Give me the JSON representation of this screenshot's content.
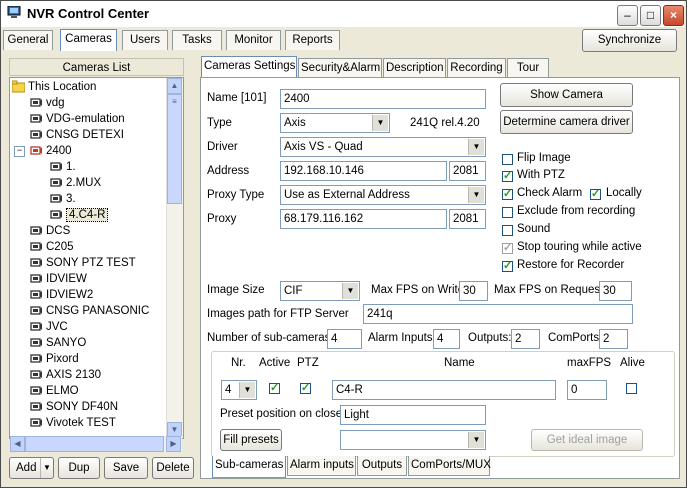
{
  "window": {
    "title": "NVR Control Center"
  },
  "main_tabs": [
    "General",
    "Cameras",
    "Users",
    "Tasks",
    "Monitor",
    "Reports"
  ],
  "sync_label": "Synchronize",
  "cameras_list": {
    "title": "Cameras List",
    "items": [
      {
        "label": "This Location"
      },
      {
        "label": "vdg"
      },
      {
        "label": "VDG-emulation"
      },
      {
        "label": "CNSG DETEXI"
      },
      {
        "label": "2400"
      },
      {
        "label": "1."
      },
      {
        "label": "2.MUX"
      },
      {
        "label": "3."
      },
      {
        "label": "4.C4-R"
      },
      {
        "label": "DCS"
      },
      {
        "label": "C205"
      },
      {
        "label": "SONY PTZ TEST"
      },
      {
        "label": "IDVIEW"
      },
      {
        "label": "IDVIEW2"
      },
      {
        "label": "CNSG PANASONIC"
      },
      {
        "label": "JVC"
      },
      {
        "label": "SANYO"
      },
      {
        "label": "Pixord"
      },
      {
        "label": "AXIS 2130"
      },
      {
        "label": "ELMO"
      },
      {
        "label": "SONY DF40N"
      },
      {
        "label": "Vivotek TEST"
      }
    ],
    "buttons": {
      "add": "Add",
      "dup": "Dup",
      "save": "Save",
      "delete": "Delete"
    }
  },
  "settings_tabs": [
    "Cameras Settings",
    "Security&Alarm",
    "Description",
    "Recording",
    "Tour"
  ],
  "form": {
    "name_label": "Name [101]",
    "name_value": "2400",
    "type_label": "Type",
    "type_value": "Axis",
    "type_version": "241Q rel.4.20",
    "driver_label": "Driver",
    "driver_value": "Axis VS - Quad",
    "address_label": "Address",
    "address_value": "192.168.10.146",
    "address_port": "2081",
    "proxy_type_label": "Proxy Type",
    "proxy_type_value": "Use as External Address",
    "proxy_label": "Proxy",
    "proxy_value": "68.179.116.162",
    "proxy_port": "2081",
    "show_camera": "Show Camera",
    "determine_driver": "Determine camera driver",
    "checkboxes": {
      "flip": "Flip Image",
      "ptz": "With PTZ",
      "alarm": "Check Alarm",
      "locally": "Locally",
      "exclude": "Exclude from recording",
      "sound": "Sound",
      "stop_touring": "Stop touring while active",
      "restore": "Restore for Recorder"
    },
    "image_size_label": "Image Size",
    "image_size_value": "CIF",
    "max_fps_write_label": "Max FPS on Write",
    "max_fps_write": "30",
    "max_fps_request_label": "Max FPS on Request",
    "max_fps_request": "30",
    "ftp_label": "Images path for FTP Server",
    "ftp_value": "241q",
    "subcam_label": "Number of sub-cameras:",
    "subcam_value": "4",
    "alarm_inputs_label": "Alarm Inputs:",
    "alarm_inputs_value": "4",
    "outputs_label": "Outputs:",
    "outputs_value": "2",
    "comports_label": "ComPorts:",
    "comports_value": "2"
  },
  "subcam": {
    "headers": {
      "nr": "Nr.",
      "active": "Active",
      "ptz": "PTZ",
      "name": "Name",
      "maxfps": "maxFPS",
      "alive": "Alive"
    },
    "nr_value": "4",
    "name_value": "C4-R",
    "maxfps_value": "0",
    "preset_label": "Preset position on close:",
    "preset_value": "Light",
    "fill_presets": "Fill presets",
    "get_ideal": "Get ideal image"
  },
  "bottom_tabs": [
    "Sub-cameras",
    "Alarm inputs",
    "Outputs",
    "ComPorts/MUX"
  ]
}
